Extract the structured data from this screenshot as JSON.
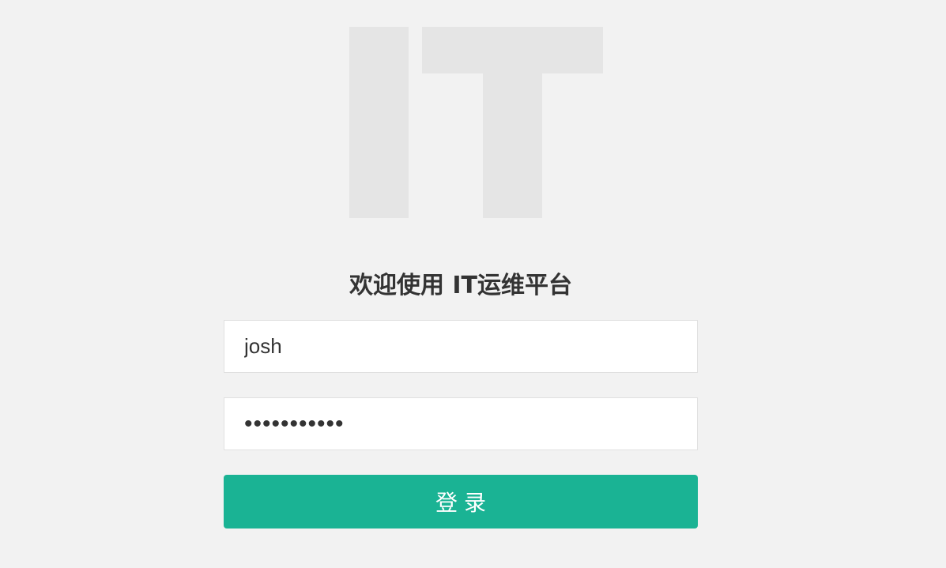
{
  "logo": {
    "text": "IT",
    "color": "#e5e5e5"
  },
  "login": {
    "title": "欢迎使用 IT运维平台",
    "username_value": "josh",
    "password_value": "•••••••••••",
    "submit_label": "登录"
  },
  "colors": {
    "background": "#f2f2f2",
    "accent": "#1ab394",
    "title_text": "#333333"
  }
}
